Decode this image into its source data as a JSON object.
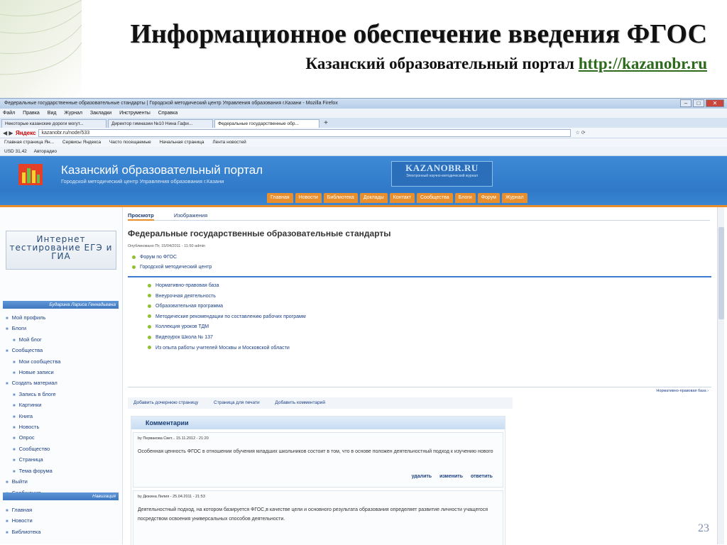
{
  "slide": {
    "title": "Информационное обеспечение введения ФГОС",
    "subtitle_prefix": "Казанский образовательный портал ",
    "subtitle_link": "http://kazanobr.ru",
    "page_number": "23"
  },
  "browser": {
    "window_title": "Федеральные государственные образовательные стандарты | Городской методический центр Управления образования г.Казани - Mozilla Firefox",
    "menu": [
      "Файл",
      "Правка",
      "Вид",
      "Журнал",
      "Закладки",
      "Инструменты",
      "Справка"
    ],
    "tabs": [
      "Некоторые казанские дороги могут...",
      "Директор гимназии №10 Нина Гафи...",
      "Федеральные государственные обр..."
    ],
    "search_engine": "Яндекс",
    "url": "kazanobr.ru/node/533",
    "bookmarks": [
      "Главная страница Ян...",
      "Сервисы Яндекса",
      "Часто посещаемые",
      "Начальная страница",
      "Лента новостей"
    ],
    "addon_items": [
      "USD 31,42",
      "Авторадио"
    ]
  },
  "site": {
    "title": "Казанский образовательный портал",
    "subtitle": "Городской методический центр Управления образования г.Казани",
    "brand": "KAZANOBR.RU",
    "brand_sub": "Электронный научно-методический журнал",
    "nav": [
      "Главная",
      "Новости",
      "Библиотека",
      "Доклады",
      "Контакт",
      "Сообщества",
      "Блоги",
      "Форум",
      "Журнал"
    ],
    "banner": "Интернет тестирование ЕГЭ и ГИА",
    "user_block_title": "Бударина Лариса Геннадьевна",
    "user_menu": [
      {
        "label": "Мой профиль",
        "level": 0
      },
      {
        "label": "Блоги",
        "level": 0
      },
      {
        "label": "Мой блог",
        "level": 1
      },
      {
        "label": "Сообщества",
        "level": 0
      },
      {
        "label": "Мои сообщества",
        "level": 1
      },
      {
        "label": "Новые записи",
        "level": 1
      },
      {
        "label": "Создать материал",
        "level": 0
      },
      {
        "label": "Запись в блоге",
        "level": 1
      },
      {
        "label": "Картинки",
        "level": 1
      },
      {
        "label": "Книга",
        "level": 1
      },
      {
        "label": "Новость",
        "level": 1
      },
      {
        "label": "Опрос",
        "level": 1
      },
      {
        "label": "Сообщество",
        "level": 1
      },
      {
        "label": "Страница",
        "level": 1
      },
      {
        "label": "Тема форума",
        "level": 1
      },
      {
        "label": "Выйти",
        "level": 0
      },
      {
        "label": "Сообщения",
        "level": 0
      }
    ],
    "nav_block_title": "Навигация",
    "nav_menu": [
      "Главная",
      "Новости",
      "Библиотека"
    ],
    "content_tabs": [
      "Просмотр",
      "Изображения"
    ],
    "page_heading": "Федеральные государственные образовательные стандарты",
    "posted": "Опубликовано Пт, 15/04/2011 - 11:50 admin",
    "top_links": [
      "Форум по ФГОС",
      "Городской методический центр"
    ],
    "links": [
      "Нормативно-правовая база",
      "Внеурочная деятельность",
      "Образовательная программа",
      "Методические рекомендации по составлению рабочих программ",
      "Коллекция уроков ТДМ",
      "Видеоурок Школа № 137",
      "Из опыта работы учителей Москвы и Московской области"
    ],
    "norm_link": "Нормативно-правовая база ›",
    "page_actions": [
      "Добавить дочернюю страницу",
      "Страница для печати",
      "Добавить комментарий"
    ],
    "comments_title": "Комментарии",
    "comments": [
      {
        "meta": "by Первакова Свет...  15.11.2012 - 21:20",
        "text": "Особенная ценность ФГОС в отношении обучения младших школьников состоит в том, что в основе положен деятельностный подход к изучению нового",
        "actions": [
          "удалить",
          "изменить",
          "ответить"
        ]
      },
      {
        "meta": "by Дюкина Лилия - 25.04.2011 - 21:53",
        "text": "Деятельностный подход, на котором базируется ФГОС,в качестве цели и основного результата образования определяет развитие личности учащегося посредством освоения универсальных способов деятельности.",
        "actions": []
      }
    ]
  }
}
